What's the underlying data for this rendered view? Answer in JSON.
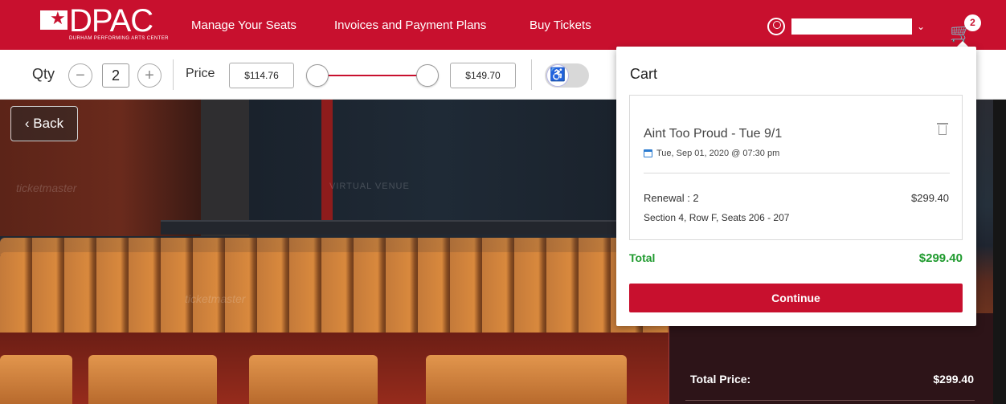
{
  "header": {
    "logo_text": "DPAC",
    "logo_subtitle": "DURHAM PERFORMING ARTS CENTER",
    "nav": [
      "Manage Your Seats",
      "Invoices and Payment Plans",
      "Buy Tickets"
    ],
    "cart_count": "2"
  },
  "toolbar": {
    "qty_label": "Qty",
    "qty_value": "2",
    "price_label": "Price",
    "price_min": "$114.76",
    "price_max": "$149.70",
    "accent_color": "#c8102e"
  },
  "venue": {
    "back_label": "Back",
    "watermarks": [
      "ticketmaster",
      "VIRTUAL VENUE",
      "ticketmaster"
    ]
  },
  "summary": {
    "total_label": "Total Price:",
    "total_value": "$299.40"
  },
  "cart": {
    "title": "Cart",
    "item": {
      "name": "Aint Too Proud - Tue 9/1",
      "date": "Tue, Sep 01, 2020 @ 07:30 pm",
      "renewal": "Renewal : 2",
      "price": "$299.40",
      "seats": "Section 4, Row F, Seats 206 - 207"
    },
    "total_label": "Total",
    "total_value": "$299.40",
    "total_color": "#1f9a2e",
    "continue_label": "Continue"
  }
}
